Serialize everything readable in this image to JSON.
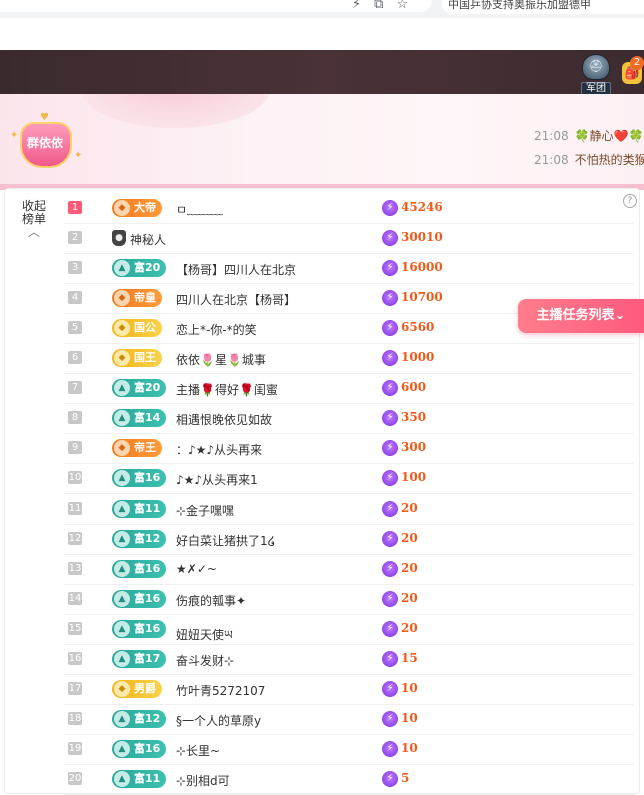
{
  "browser": {
    "tab_title": "中国乒协支持奥振乐加盟德甲",
    "icons": [
      "bolt-icon",
      "cast-icon",
      "star-icon"
    ]
  },
  "topnav": {
    "army_label": "军团",
    "bag_badge": "2"
  },
  "host": {
    "badge_text": "群依依"
  },
  "chat": [
    {
      "time": "21:08",
      "name": "🍀静心❤️🍀",
      "text": ""
    },
    {
      "time": "21:08",
      "name": "",
      "text": "不怕热的类猴"
    }
  ],
  "sidebar": {
    "collapse_label_1": "收起",
    "collapse_label_2": "榜单",
    "collapse_arrow": "︿"
  },
  "help_icon": "?",
  "task_button": {
    "label": "主播任务列表⌄"
  },
  "colors": {
    "score": "#f05a18",
    "accent_pink": "#ff5a7d",
    "rank_top": "#ff5a78"
  },
  "leaderboard": [
    {
      "rank": "1",
      "level": "大帝",
      "level_style": "orange",
      "name": "ㅁ﹏﹏﹏",
      "score": "45246"
    },
    {
      "rank": "2",
      "level": "",
      "level_style": "none",
      "mystery": true,
      "name": "神秘人",
      "score": "30010"
    },
    {
      "rank": "3",
      "level": "富20",
      "level_style": "teal",
      "name": "【杨哥】四川人在北京",
      "score": "16000"
    },
    {
      "rank": "4",
      "level": "帝皇",
      "level_style": "orange",
      "name": "四川人在北京【杨哥】",
      "score": "10700"
    },
    {
      "rank": "5",
      "level": "国公",
      "level_style": "gold",
      "name": "恋上*-你-*的笑",
      "score": "6560"
    },
    {
      "rank": "6",
      "level": "国王",
      "level_style": "gold",
      "name": "依依🌷星🌷城事",
      "score": "1000"
    },
    {
      "rank": "7",
      "level": "富20",
      "level_style": "teal",
      "name": "主播🌹得好🌹闺蜜",
      "score": "600"
    },
    {
      "rank": "8",
      "level": "富14",
      "level_style": "teal",
      "name": "相遇恨晚依见如故",
      "score": "350"
    },
    {
      "rank": "9",
      "level": "帝王",
      "level_style": "orange",
      "name": "：♪★♪从头再来",
      "score": "300"
    },
    {
      "rank": "10",
      "level": "富16",
      "level_style": "teal",
      "name": "♪★♪从头再来1",
      "score": "100"
    },
    {
      "rank": "11",
      "level": "富11",
      "level_style": "teal",
      "name": "⊹金子嘿嘿",
      "score": "20"
    },
    {
      "rank": "12",
      "level": "富12",
      "level_style": "teal",
      "name": "好白菜让猪拱了1໒",
      "score": "20"
    },
    {
      "rank": "13",
      "level": "富16",
      "level_style": "teal",
      "name": "★✗✓~",
      "score": "20"
    },
    {
      "rank": "14",
      "level": "富16",
      "level_style": "teal",
      "name": "伤痕的瓡事✦",
      "score": "20"
    },
    {
      "rank": "15",
      "level": "富16",
      "level_style": "teal",
      "name": "妞妞天使ཡ",
      "score": "20"
    },
    {
      "rank": "16",
      "level": "富17",
      "level_style": "teal",
      "name": "奋斗发财⊹",
      "score": "15"
    },
    {
      "rank": "17",
      "level": "男爵",
      "level_style": "gold",
      "name": "竹叶青5272107",
      "score": "10"
    },
    {
      "rank": "18",
      "level": "富12",
      "level_style": "teal",
      "name": "§一个人的草原y",
      "score": "10"
    },
    {
      "rank": "19",
      "level": "富16",
      "level_style": "teal",
      "name": "⊹长里~",
      "score": "10"
    },
    {
      "rank": "20",
      "level": "富11",
      "level_style": "teal",
      "name": "⊹别相d可",
      "score": "5"
    }
  ]
}
